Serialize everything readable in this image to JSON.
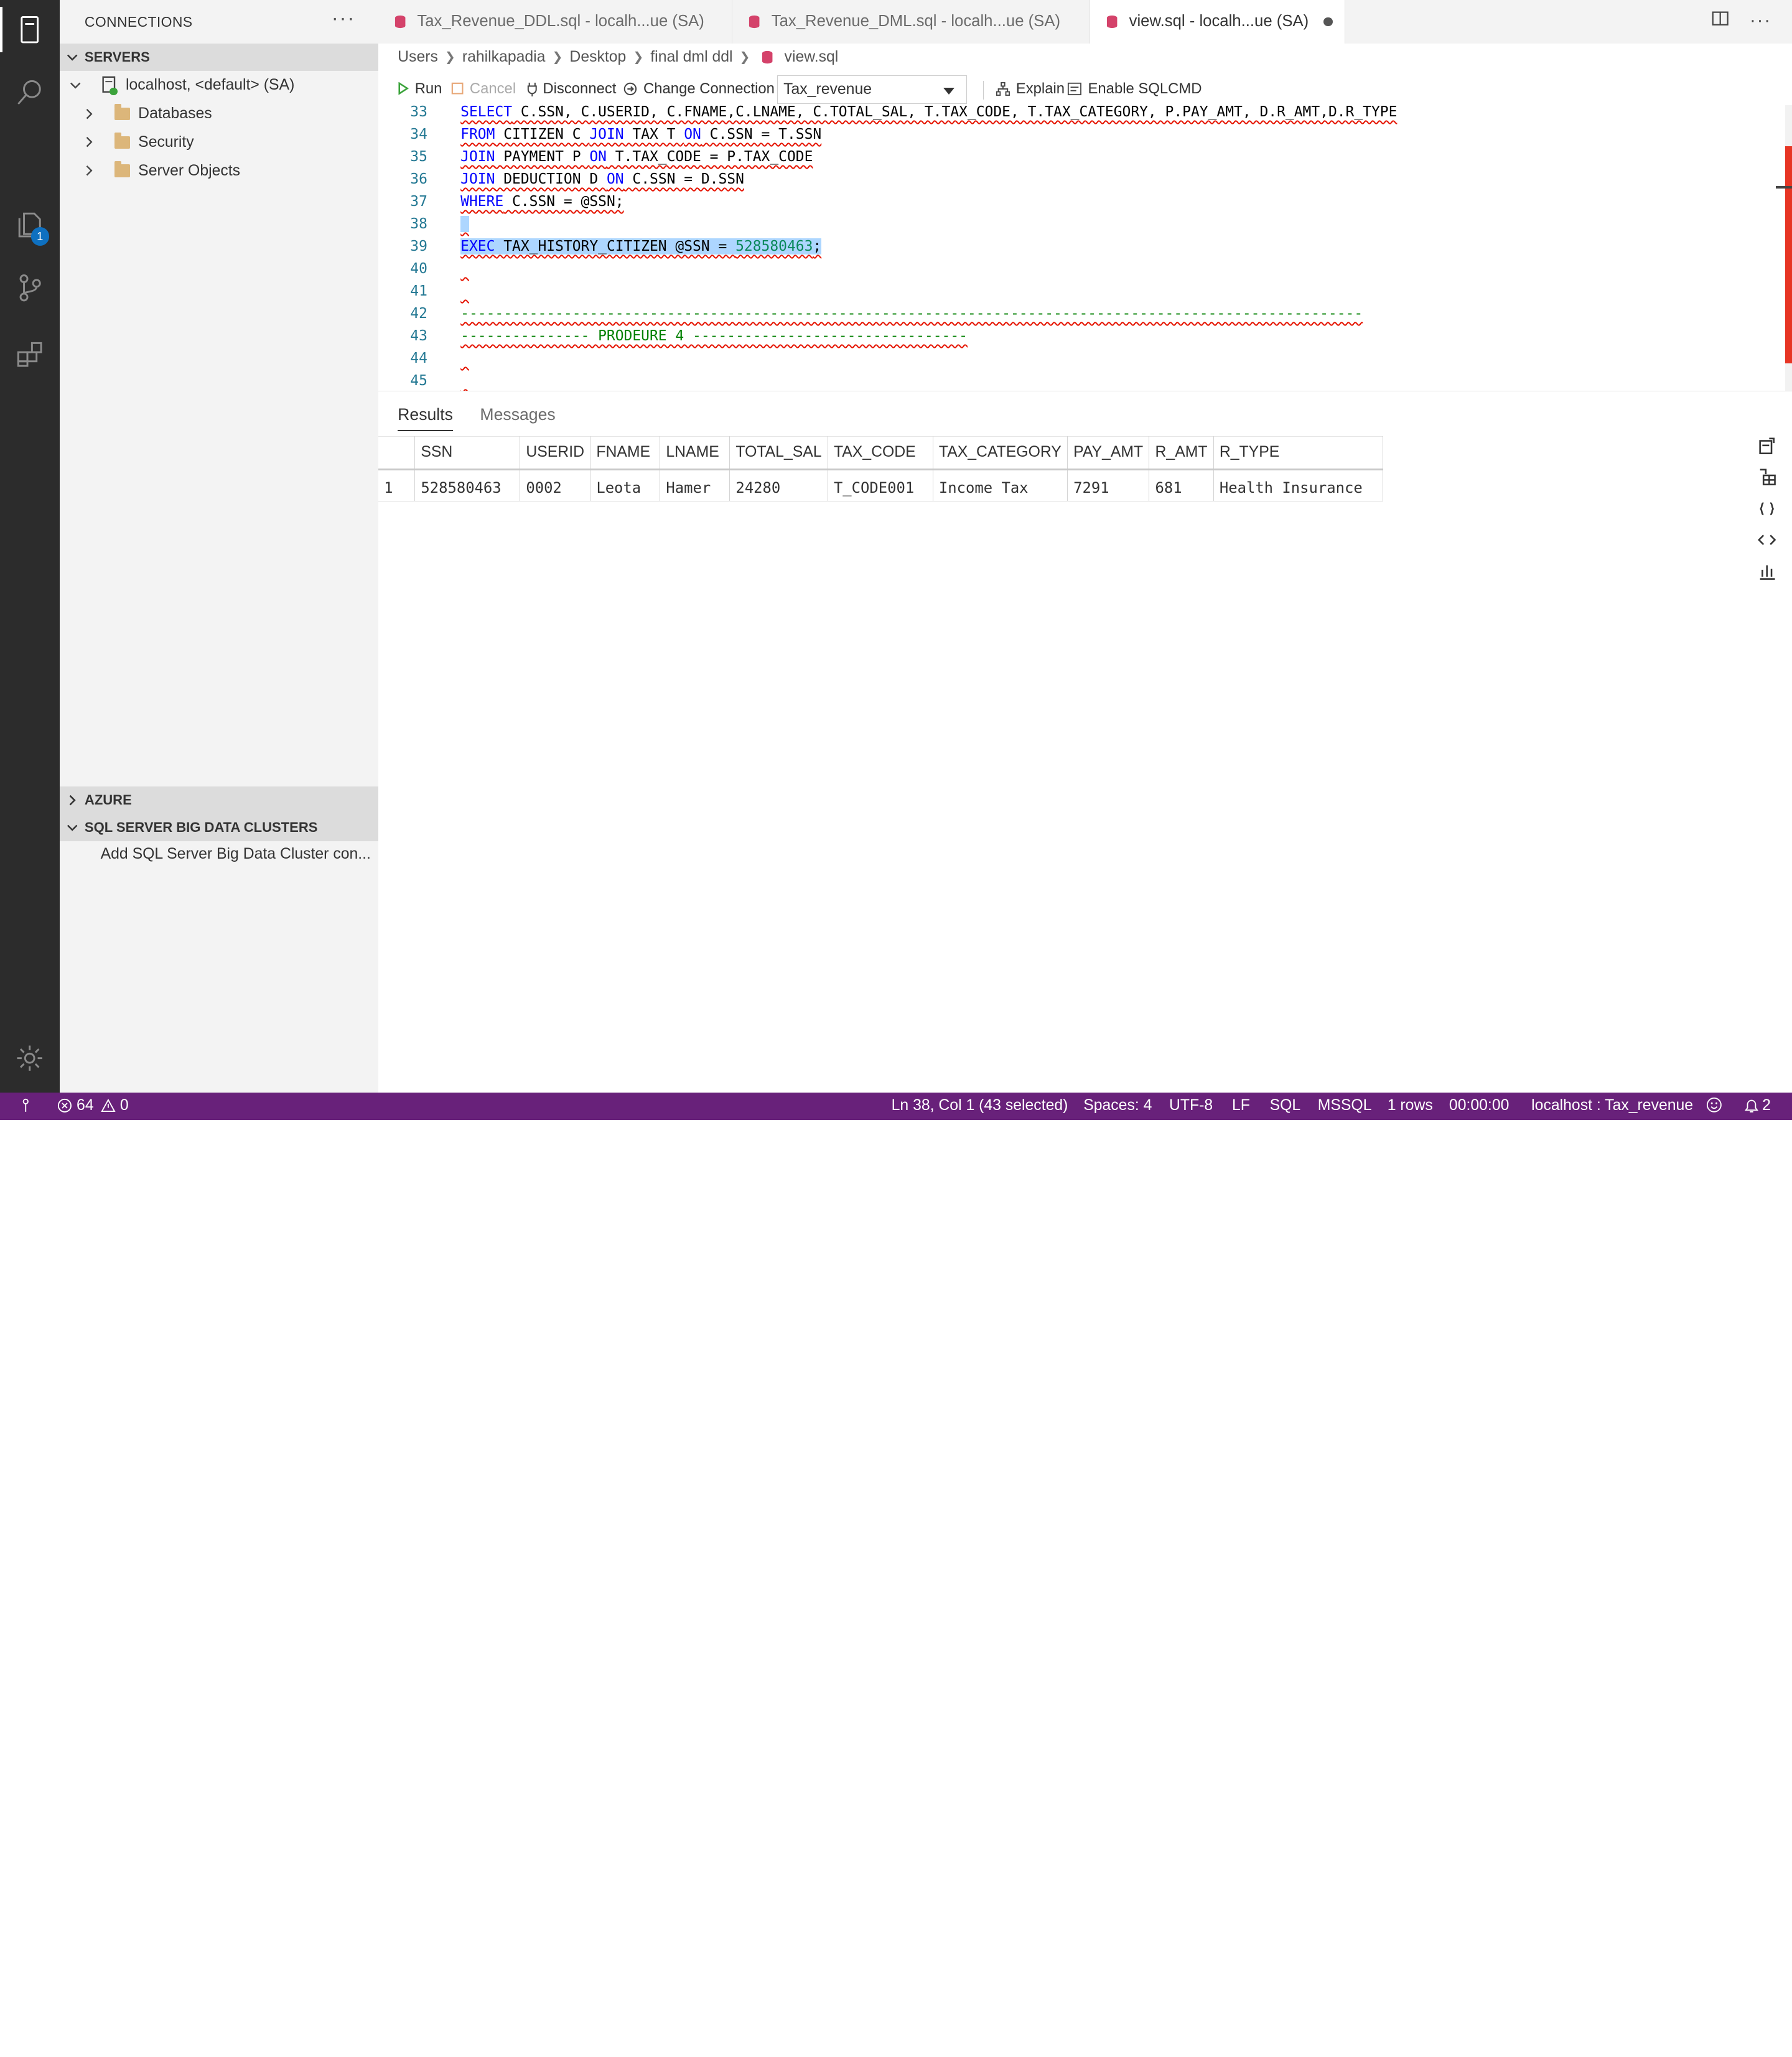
{
  "activity": {
    "items": [
      "connections-icon",
      "search-icon",
      "explorer-icon",
      "source-control-icon",
      "extensions-icon"
    ],
    "explorer_badge": "1",
    "settings": "gear-icon"
  },
  "sidebar": {
    "title": "CONNECTIONS",
    "more": "···",
    "servers_header": "SERVERS",
    "server_label": "localhost, <default> (SA)",
    "folders": [
      "Databases",
      "Security",
      "Server Objects"
    ],
    "azure_header": "AZURE",
    "bigdata_header": "SQL SERVER BIG DATA CLUSTERS",
    "bigdata_item": "Add SQL Server Big Data Cluster con..."
  },
  "tabs": [
    {
      "label": "Tax_Revenue_DDL.sql - localh...ue (SA)",
      "active": false
    },
    {
      "label": "Tax_Revenue_DML.sql - localh...ue (SA)",
      "active": false
    },
    {
      "label": "view.sql - localh...ue (SA)",
      "active": true
    }
  ],
  "breadcrumb": [
    "Users",
    "rahilkapadia",
    "Desktop",
    "final dml ddl",
    "view.sql"
  ],
  "toolbar": {
    "run": "Run",
    "cancel": "Cancel",
    "disconnect": "Disconnect",
    "change_connection": "Change Connection",
    "database": "Tax_revenue",
    "explain": "Explain",
    "sqlcmd": "Enable SQLCMD"
  },
  "editor": {
    "line_numbers": [
      "33",
      "34",
      "35",
      "36",
      "37",
      "38",
      "39",
      "40",
      "41",
      "42",
      "43",
      "44",
      "45"
    ],
    "l33_kw": "SELECT",
    "l33_rest": " C.SSN, C.USERID, C.FNAME,C.LNAME, C.TOTAL_SAL, T.TAX_CODE, T.TAX_CATEGORY, P.PAY_AMT, D.R_AMT,D.R_TYPE",
    "l34_a": "FROM",
    "l34_b": " CITIZEN C ",
    "l34_c": "JOIN",
    "l34_d": " TAX T ",
    "l34_e": "ON",
    "l34_f": " C.SSN = T.SSN",
    "l35_a": "JOIN",
    "l35_b": " PAYMENT P ",
    "l35_c": "ON",
    "l35_d": " T.TAX_CODE = P.TAX_CODE",
    "l36_a": "JOIN",
    "l36_b": " DEDUCTION D ",
    "l36_c": "ON",
    "l36_d": " C.SSN = D.SSN",
    "l37_a": "WHERE",
    "l37_b": " C.SSN = @SSN;",
    "l39_a": "EXEC",
    "l39_b": " TAX_HISTORY_CITIZEN @SSN = ",
    "l39_c": "528580463",
    "l39_d": ";",
    "l42": "---------------------------------------------------------------------------------------------------------",
    "l43": "--------------- PRODEURE 4 --------------------------------"
  },
  "results": {
    "tab_results": "Results",
    "tab_messages": "Messages",
    "columns": [
      "SSN",
      "USERID",
      "FNAME",
      "LNAME",
      "TOTAL_SAL",
      "TAX_CODE",
      "TAX_CATEGORY",
      "PAY_AMT",
      "R_AMT",
      "R_TYPE"
    ],
    "rows": [
      {
        "n": "1",
        "cells": [
          "528580463",
          "0002",
          "Leota",
          "Hamer",
          "24280",
          "T_CODE001",
          "Income Tax",
          "7291",
          "681",
          "Health Insurance"
        ]
      }
    ],
    "tools": [
      "save-as-csv-icon",
      "save-as-excel-icon",
      "save-as-json-icon",
      "save-as-xml-icon",
      "chart-icon"
    ]
  },
  "status": {
    "errors": "64",
    "warnings": "0",
    "position": "Ln 38, Col 1 (43 selected)",
    "spaces": "Spaces: 4",
    "encoding": "UTF-8",
    "eol": "LF",
    "language": "SQL",
    "provider": "MSSQL",
    "rows": "1 rows",
    "time": "00:00:00",
    "connection": "localhost : Tax_revenue",
    "notifications": "2"
  },
  "colors": {
    "activity_bar": "#2c2c2c",
    "status_bar": "#68217a",
    "keyword": "#0000ff",
    "number": "#09885a",
    "comment": "#008000",
    "selection": "#add6ff"
  }
}
